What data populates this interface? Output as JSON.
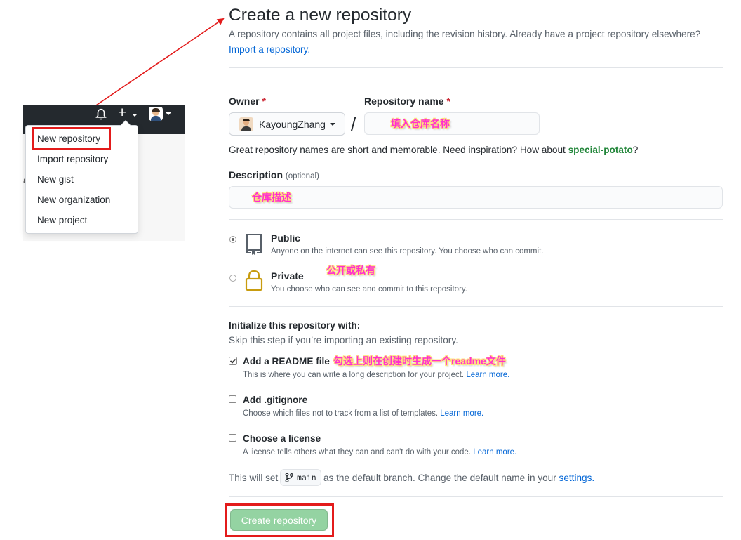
{
  "colors": {
    "accent_red": "#e31b1b",
    "link": "#0366d6",
    "green": "#22863a",
    "annotation": "#ff2fd0",
    "button_disabled": "#94d3a2"
  },
  "left_panel": {
    "stub_text": "a",
    "menu_items": [
      {
        "label": "New repository",
        "icon": ""
      },
      {
        "label": "Import repository"
      },
      {
        "label": "New gist"
      },
      {
        "label": "New organization"
      },
      {
        "label": "New project"
      }
    ],
    "icons": [
      "bell-icon",
      "plus-icon",
      "avatar"
    ]
  },
  "page": {
    "title": "Create a new repository",
    "subtitle": "A repository contains all project files, including the revision history. Already have a project repository elsewhere?",
    "import_link": "Import a repository."
  },
  "form": {
    "owner_label": "Owner",
    "required_mark": "*",
    "owner_value": "KayoungZhang",
    "slash": "/",
    "repo_name_label": "Repository name",
    "repo_name_annotation": "填入仓库名称",
    "name_hint_prefix": "Great repository names are short and memorable. Need inspiration? How about",
    "name_hint_suggestion": "special-potato",
    "name_hint_suffix": "?",
    "description_label": "Description",
    "description_optional": "(optional)",
    "description_annotation": "仓库描述",
    "visibility": {
      "selected": "public",
      "annotation": "公开或私有",
      "public_title": "Public",
      "public_desc": "Anyone on the internet can see this repository. You choose who can commit.",
      "private_title": "Private",
      "private_desc": "You choose who can see and commit to this repository."
    },
    "init": {
      "heading": "Initialize this repository with:",
      "subheading": "Skip this step if you’re importing an existing repository.",
      "readme_label": "Add a README file",
      "readme_checked": true,
      "readme_annotation": "勾选上则在创建时生成一个readme文件",
      "readme_desc": "This is where you can write a long description for your project.",
      "gitignore_label": "Add .gitignore",
      "gitignore_checked": false,
      "gitignore_desc": "Choose which files not to track from a list of templates.",
      "license_label": "Choose a license",
      "license_checked": false,
      "license_desc": "A license tells others what they can and can't do with your code.",
      "learn_more": "Learn more."
    },
    "branch_prefix": "This will set",
    "branch_name": "main",
    "branch_suffix": "as the default branch. Change the default name in your",
    "settings_link": "settings.",
    "submit_label": "Create repository"
  }
}
